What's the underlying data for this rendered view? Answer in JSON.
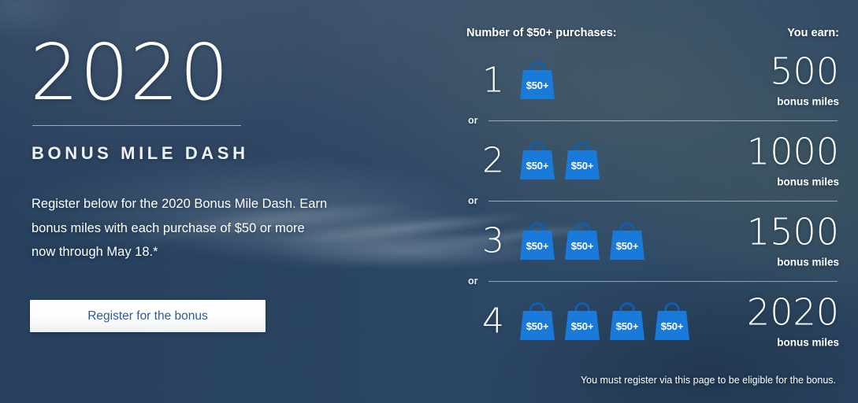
{
  "promo": {
    "year_title": "2020",
    "subtitle": "BONUS MILE DASH",
    "blurb": "Register below for the 2020 Bonus Mile Dash. Earn bonus miles with each purchase of $50 or more now through May 18.*",
    "register_button": "Register for the bonus",
    "footnote": "You must register via this page to be eligible for the bonus."
  },
  "table": {
    "head_purchases": "Number of $50+ purchases:",
    "head_earn": "You earn:",
    "or_label": "or",
    "bag_label": "$50+",
    "earn_unit": "bonus miles",
    "tiers": [
      {
        "count": "1",
        "bags": 1,
        "earn": "500",
        "unit": "bonus miles"
      },
      {
        "count": "2",
        "bags": 2,
        "earn": "1000",
        "unit": "bonus miles"
      },
      {
        "count": "3",
        "bags": 3,
        "earn": "1500",
        "unit": "bonus miles"
      },
      {
        "count": "4",
        "bags": 4,
        "earn": "2020",
        "unit": "bonus miles"
      }
    ]
  },
  "colors": {
    "bag_blue": "#1a7ad9",
    "bag_handle_blue": "#0f5fae",
    "button_text_blue": "#2a5c9b",
    "text_white": "#ffffff"
  }
}
